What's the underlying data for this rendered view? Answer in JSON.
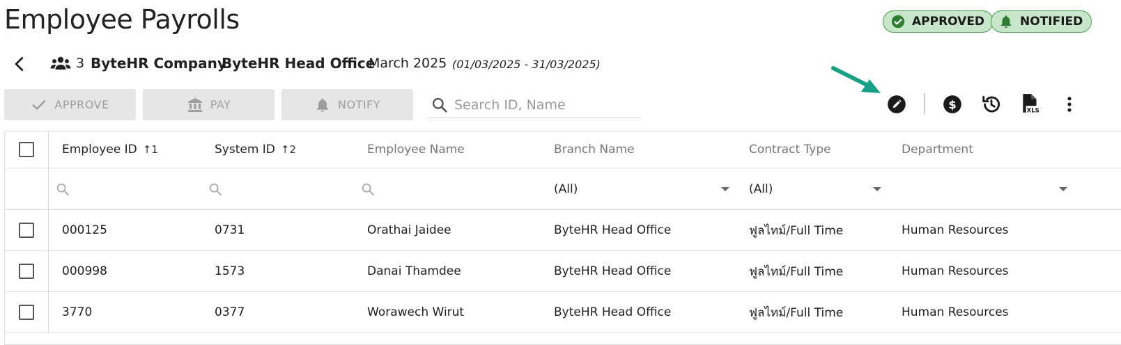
{
  "page": {
    "title": "Employee Payrolls"
  },
  "statuses": [
    {
      "label": "APPROVED",
      "icon": "check-circle-icon"
    },
    {
      "label": "NOTIFIED",
      "icon": "bell-icon"
    }
  ],
  "context": {
    "employee_count": "3",
    "company": "ByteHR Company",
    "office": "ByteHR Head Office",
    "period": "March 2025",
    "date_range": "(01/03/2025 - 31/03/2025)"
  },
  "actions": {
    "approve": "APPROVE",
    "pay": "PAY",
    "notify": "NOTIFY"
  },
  "search": {
    "placeholder": "Search ID, Name",
    "value": ""
  },
  "toolbar": {
    "icons": [
      "edit-icon",
      "dollar-icon",
      "history-icon",
      "xls-file-icon",
      "more-vert-icon"
    ],
    "xls_label": "XLS"
  },
  "table": {
    "columns": [
      {
        "label": "Employee ID",
        "sort": "↑1"
      },
      {
        "label": "System ID",
        "sort": "↑2"
      },
      {
        "label": "Employee Name"
      },
      {
        "label": "Branch Name"
      },
      {
        "label": "Contract Type"
      },
      {
        "label": "Department"
      }
    ],
    "filters": {
      "branch": "(All)",
      "contract": "(All)",
      "department": ""
    },
    "rows": [
      {
        "employee_id": "000125",
        "system_id": "0731",
        "name": "Orathai Jaidee",
        "branch": "ByteHR Head Office",
        "contract": "ฟูลไทม์/Full Time",
        "department": "Human Resources"
      },
      {
        "employee_id": "000998",
        "system_id": "1573",
        "name": "Danai Thamdee",
        "branch": "ByteHR Head Office",
        "contract": "ฟูลไทม์/Full Time",
        "department": "Human Resources"
      },
      {
        "employee_id": "3770",
        "system_id": "0377",
        "name": "Worawech Wirut",
        "branch": "ByteHR Head Office",
        "contract": "ฟูลไทม์/Full Time",
        "department": "Human Resources"
      }
    ]
  },
  "colors": {
    "badge_fill": "#c8e6c9",
    "badge_border": "#43a047",
    "badge_icon": "#2e7d32",
    "arrow": "#16a085",
    "disabled_button": "#e6e6e6"
  }
}
